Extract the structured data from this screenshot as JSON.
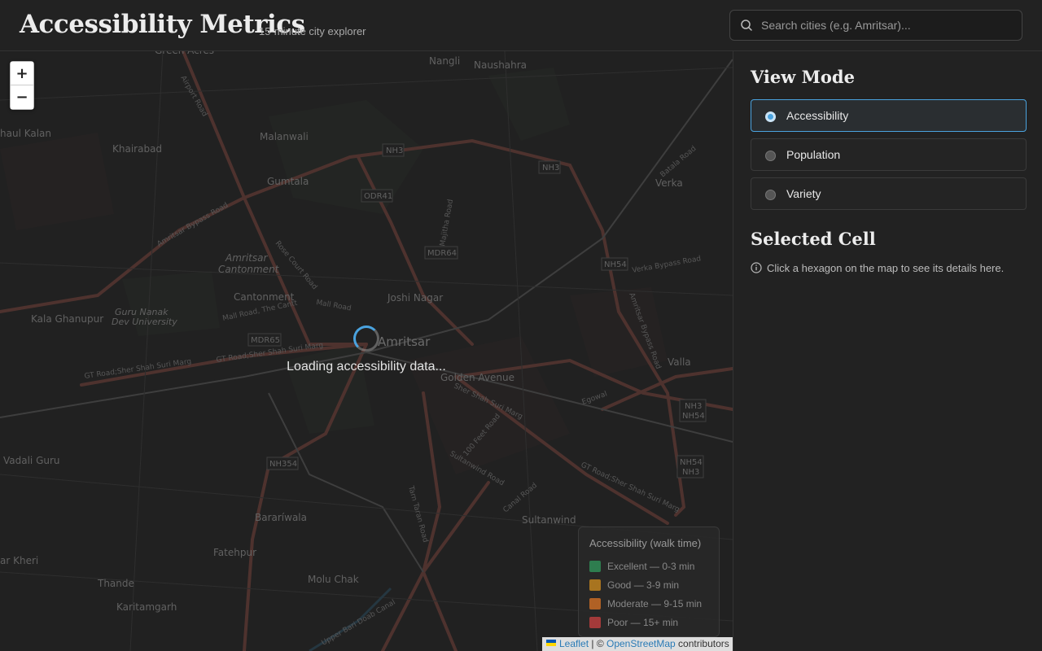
{
  "header": {
    "title": "Accessibility Metrics",
    "subtitle": "15-minute city explorer",
    "search_placeholder": "Search cities (e.g. Amritsar)..."
  },
  "map": {
    "zoom_in": "+",
    "zoom_out": "−",
    "loading_text": "Loading accessibility data...",
    "place_labels": [
      "Green Acres",
      "Nangli",
      "Naushahra",
      "Malanwali",
      "Khairabad",
      "NH3",
      "NH3",
      "Gumtala",
      "ODR41",
      "Verka",
      "Amritsar Cantonment",
      "MDR64",
      "NH54",
      "Cantonment",
      "Joshi Nagar",
      "Kala Ghanupur",
      "Guru Nanak Dev University",
      "MDR65",
      "Amritsar",
      "Valla",
      "Golden Avenue",
      "NH3 NH54",
      "Vadali Guru",
      "NH354",
      "NH54 NH3",
      "Sultanwind",
      "Barariwala",
      "Fatehpur",
      "Molu Chak",
      "Thande",
      "Karitamgarh",
      "Amritsar Bypass Road",
      "Mall Road",
      "GT Road;Sher Shah Suri Marg",
      "Verka Bypass Road",
      "Batala Road",
      "Majitha Road",
      "100 Feet Road",
      "Sultanwind Road",
      "Tarn Taran Road",
      "Canal Road",
      "Upper Bari Doab Canal",
      "Airport Road",
      "Rose Court Road",
      "Mall Road, The Cantt",
      "Egowal",
      "haul Kalan",
      "ar Kheri"
    ],
    "legend": {
      "title": "Accessibility (walk time)",
      "items": [
        {
          "label": "Excellent — 0-3 min",
          "color": "#2e7d4f"
        },
        {
          "label": "Good — 3-9 min",
          "color": "#a8741f"
        },
        {
          "label": "Moderate — 9-15 min",
          "color": "#b06125"
        },
        {
          "label": "Poor — 15+ min",
          "color": "#a33a3a"
        }
      ]
    },
    "attribution": {
      "leaflet": "Leaflet",
      "sep": " | © ",
      "osm": "OpenStreetMap",
      "suffix": " contributors"
    }
  },
  "panel": {
    "view_mode_title": "View Mode",
    "modes": [
      {
        "label": "Accessibility",
        "selected": true
      },
      {
        "label": "Population",
        "selected": false
      },
      {
        "label": "Variety",
        "selected": false
      }
    ],
    "selected_cell_title": "Selected Cell",
    "selected_cell_hint": "Click a hexagon on the map to see its details here."
  },
  "colors": {
    "accent": "#4aa3df",
    "road": "#7a4a44",
    "background": "#1e1e1e"
  }
}
